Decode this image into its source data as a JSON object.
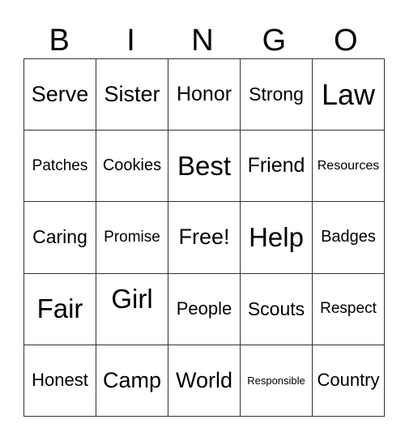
{
  "header": {
    "letters": [
      "B",
      "I",
      "N",
      "G",
      "O"
    ]
  },
  "rows": [
    [
      "Serve",
      "Sister",
      "Honor",
      "Strong",
      "Law"
    ],
    [
      "Patches",
      "Cookies",
      "Best",
      "Friend",
      "Resources"
    ],
    [
      "Caring",
      "Promise",
      "Free!",
      "Help",
      "Badges"
    ],
    [
      "Fair",
      "Girl",
      "People",
      "Scouts",
      "Respect"
    ],
    [
      "Honest",
      "Camp",
      "World",
      "Responsible",
      "Country"
    ]
  ]
}
